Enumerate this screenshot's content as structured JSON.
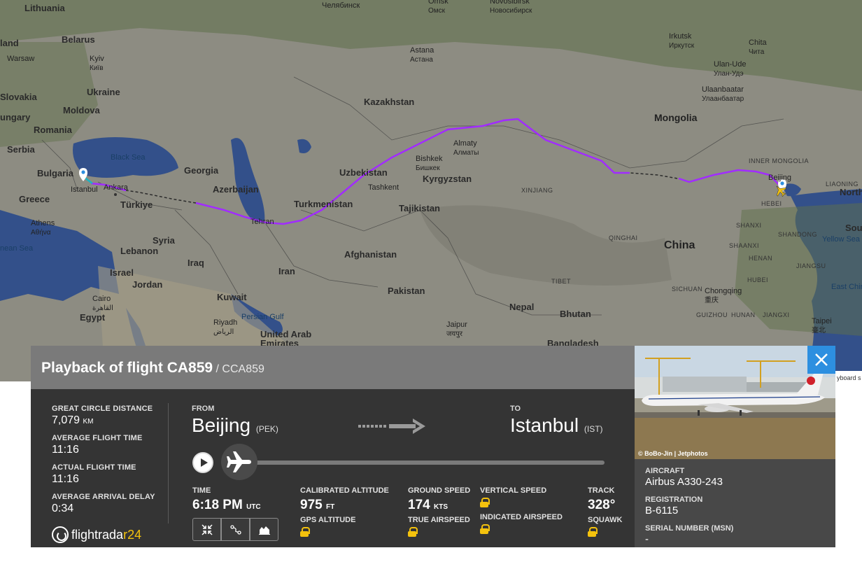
{
  "map": {
    "labels": [
      {
        "text": "Lithuania",
        "cls": "country"
      },
      {
        "text": "Челябинск",
        "cls": "city"
      },
      {
        "text": "Omsk",
        "cls": "city",
        "sub": "Омск"
      },
      {
        "text": "Novosibirsk",
        "cls": "city",
        "sub": "Новосибирск"
      },
      {
        "text": "Belarus",
        "cls": "country"
      },
      {
        "text": "Kyiv",
        "cls": "city",
        "sub": "Київ"
      },
      {
        "text": "Astana",
        "cls": "city",
        "sub": "Астана"
      },
      {
        "text": "Irkutsk",
        "cls": "city",
        "sub": "Иркутск"
      },
      {
        "text": "Chita",
        "cls": "city",
        "sub": "Чита"
      },
      {
        "text": "Ulan-Ude",
        "cls": "city",
        "sub": "Улан-Удэ"
      },
      {
        "text": "Ukraine",
        "cls": "country"
      },
      {
        "text": "Slovakia",
        "cls": "country"
      },
      {
        "text": "Moldova",
        "cls": "country"
      },
      {
        "text": "Kazakhstan",
        "cls": "country"
      },
      {
        "text": "Ulaanbaatar",
        "cls": "city",
        "sub": "Улаанбаатар"
      },
      {
        "text": "ungary",
        "cls": "country"
      },
      {
        "text": "Romania",
        "cls": "country"
      },
      {
        "text": "Mongolia",
        "cls": "country"
      },
      {
        "text": "Serbia",
        "cls": "country"
      },
      {
        "text": "Black Sea",
        "cls": "sea"
      },
      {
        "text": "Almaty",
        "cls": "city",
        "sub": "Алматы"
      },
      {
        "text": "Bishkek",
        "cls": "city",
        "sub": "Бишкек"
      },
      {
        "text": "Georgia",
        "cls": "country"
      },
      {
        "text": "Uzbekistan",
        "cls": "country"
      },
      {
        "text": "Kyrgyzstan",
        "cls": "country"
      },
      {
        "text": "INNER MONGOLIA",
        "cls": "province"
      },
      {
        "text": "Bulgaria",
        "cls": "country"
      },
      {
        "text": "Ankara",
        "cls": "city"
      },
      {
        "text": "Istanbul",
        "cls": "city"
      },
      {
        "text": "Azerbaijan",
        "cls": "country"
      },
      {
        "text": "Tashkent",
        "cls": "city"
      },
      {
        "text": "XINJIANG",
        "cls": "province"
      },
      {
        "text": "Beijing",
        "cls": "city"
      },
      {
        "text": "LIAONING",
        "cls": "province"
      },
      {
        "text": "North",
        "cls": "country"
      },
      {
        "text": "Greece",
        "cls": "country"
      },
      {
        "text": "Türkiye",
        "cls": "country"
      },
      {
        "text": "Turkmenistan",
        "cls": "country"
      },
      {
        "text": "Tajikistan",
        "cls": "country"
      },
      {
        "text": "HEBEI",
        "cls": "province"
      },
      {
        "text": "Tehran",
        "cls": "city"
      },
      {
        "text": "Athens",
        "cls": "city",
        "sub": "Αθήνα"
      },
      {
        "text": "SHANXI",
        "cls": "province"
      },
      {
        "text": "QINGHAI",
        "cls": "province"
      },
      {
        "text": "SHANDONG",
        "cls": "province"
      },
      {
        "text": "Sou",
        "cls": "country"
      },
      {
        "text": "nean Sea",
        "cls": "sea"
      },
      {
        "text": "Syria",
        "cls": "country"
      },
      {
        "text": "Lebanon",
        "cls": "country"
      },
      {
        "text": "China",
        "cls": "big"
      },
      {
        "text": "SHAANXI",
        "cls": "province"
      },
      {
        "text": "Yellow Sea",
        "cls": "sea"
      },
      {
        "text": "Afghanistan",
        "cls": "country"
      },
      {
        "text": "Iraq",
        "cls": "country"
      },
      {
        "text": "HENAN",
        "cls": "province"
      },
      {
        "text": "Israel",
        "cls": "country"
      },
      {
        "text": "Iran",
        "cls": "country"
      },
      {
        "text": "JIANGSU",
        "cls": "province"
      },
      {
        "text": "Jordan",
        "cls": "country"
      },
      {
        "text": "TIBET",
        "cls": "province"
      },
      {
        "text": "SICHUAN",
        "cls": "province"
      },
      {
        "text": "HUBEI",
        "cls": "province"
      },
      {
        "text": "East Chir",
        "cls": "sea"
      },
      {
        "text": "Pakistan",
        "cls": "country"
      },
      {
        "text": "Chongqing",
        "cls": "city",
        "sub": "重庆"
      },
      {
        "text": "Kuwait",
        "cls": "country"
      },
      {
        "text": "Cairo",
        "cls": "city",
        "sub": "القاهرة"
      },
      {
        "text": "Nepal",
        "cls": "country"
      },
      {
        "text": "Bhutan",
        "cls": "country"
      },
      {
        "text": "GUIZHOU",
        "cls": "province"
      },
      {
        "text": "HUNAN",
        "cls": "province"
      },
      {
        "text": "JIANGXI",
        "cls": "province"
      },
      {
        "text": "Egypt",
        "cls": "country"
      },
      {
        "text": "Persian Gulf",
        "cls": "sea"
      },
      {
        "text": "Riyadh",
        "cls": "city",
        "sub": "الرياض"
      },
      {
        "text": "Taipei",
        "cls": "city",
        "sub": "臺北"
      },
      {
        "text": "Jaipur",
        "cls": "city",
        "sub": "जयपुर"
      },
      {
        "text": "United Arab Emirates",
        "cls": "country"
      },
      {
        "text": "Bangladesh",
        "cls": "country"
      },
      {
        "text": "Warsaw",
        "cls": "city"
      },
      {
        "text": "land",
        "cls": "country"
      }
    ]
  },
  "right_strip": "yboard s",
  "panel": {
    "title": "Playback of flight CA859",
    "callsign": "/ CCA859",
    "stats": [
      {
        "label": "GREAT CIRCLE DISTANCE",
        "value": "7,079",
        "unit": "KM"
      },
      {
        "label": "AVERAGE FLIGHT TIME",
        "value": "11:16",
        "unit": ""
      },
      {
        "label": "ACTUAL FLIGHT TIME",
        "value": "11:16",
        "unit": ""
      },
      {
        "label": "AVERAGE ARRIVAL DELAY",
        "value": "0:34",
        "unit": ""
      }
    ],
    "logo": {
      "part1": "flightrada",
      "part2": "r",
      "part3": "24"
    },
    "from": {
      "label": "FROM",
      "city": "Beijing",
      "code": "(PEK)"
    },
    "to": {
      "label": "TO",
      "city": "Istanbul",
      "code": "(IST)"
    },
    "metrics": {
      "time_label": "TIME",
      "time_value": "6:18 PM",
      "time_unit": "UTC",
      "cal_alt_label": "CALIBRATED ALTITUDE",
      "cal_alt_value": "975",
      "cal_alt_unit": "FT",
      "gps_alt_label": "GPS ALTITUDE",
      "ground_speed_label": "GROUND SPEED",
      "ground_speed_value": "174",
      "ground_speed_unit": "KTS",
      "true_airspeed_label": "TRUE AIRSPEED",
      "vertical_speed_label": "VERTICAL SPEED",
      "indicated_airspeed_label": "INDICATED AIRSPEED",
      "track_label": "TRACK",
      "track_value": "328°",
      "squawk_label": "SQUAWK"
    },
    "playback_progress": 0.0
  },
  "aircraft": {
    "photo_credit": "© BoBo-Jin | Jetphotos",
    "aircraft_label": "AIRCRAFT",
    "aircraft_value": "Airbus A330-243",
    "registration_label": "REGISTRATION",
    "registration_value": "B-6115",
    "serial_label": "SERIAL NUMBER (MSN)",
    "serial_value": "-"
  },
  "colors": {
    "route_flown": "#a12cff",
    "route_gap": "#2b2b2b",
    "accent": "#f4c20d",
    "close_button": "#2d8fe0"
  }
}
